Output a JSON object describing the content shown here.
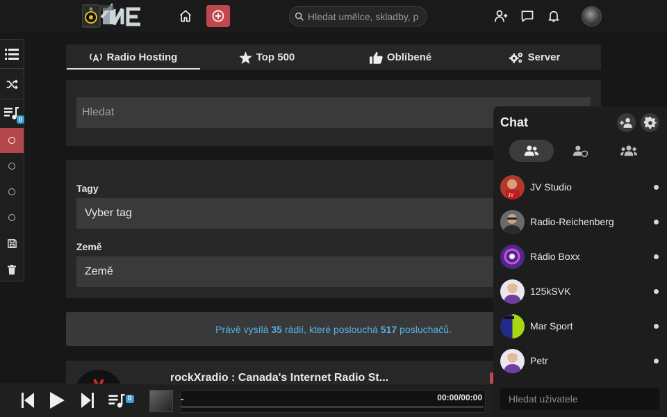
{
  "header": {
    "search_placeholder": "Hledat umělce, skladby, p"
  },
  "sidebar": {
    "queue_count": "0"
  },
  "tabs": [
    {
      "label": "Radio Hosting"
    },
    {
      "label": "Top 500"
    },
    {
      "label": "Oblíbené"
    },
    {
      "label": "Server"
    }
  ],
  "search_panel": {
    "placeholder": "Hledat"
  },
  "filters": {
    "tags_label": "Tagy",
    "tags_value": "Vyber tag",
    "country_label": "Země",
    "country_value": "Země"
  },
  "status": {
    "prefix": "Právě vysílá",
    "stations": "35",
    "middle": "rádií, které poslouchá",
    "listeners": "517",
    "suffix": "posluchačů."
  },
  "station": {
    "title": "rockXradio : Canada's Internet Radio St..."
  },
  "chat": {
    "title": "Chat",
    "users": [
      {
        "name": "JV Studio"
      },
      {
        "name": "Radio-Reichenberg"
      },
      {
        "name": "Rádio Boxx"
      },
      {
        "name": "125kSVK"
      },
      {
        "name": "Mar Sport"
      },
      {
        "name": "Petr"
      }
    ],
    "search_placeholder": "Hledat uživatele"
  },
  "player": {
    "track": "-",
    "time": "00:00/00:00",
    "queue_count": "0"
  },
  "colors": {
    "accent_red": "#c0484d",
    "info_blue": "#56b0e4",
    "badge_blue": "#3aa0d4"
  }
}
